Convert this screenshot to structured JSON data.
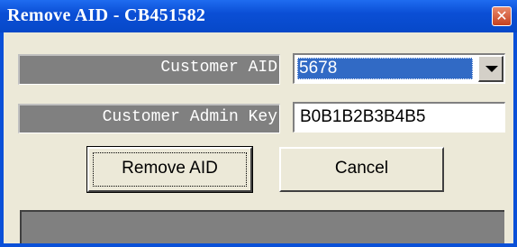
{
  "window": {
    "title": "Remove AID - CB451582",
    "close_icon": "close-icon",
    "titlebar_color": "#0a50d8",
    "close_color": "#c4401f"
  },
  "form": {
    "customer_aid_label": "Customer AID",
    "customer_aid_value": "5678",
    "customer_admin_key_label": "Customer Admin Key",
    "customer_admin_key_value": "B0B1B2B3B4B5"
  },
  "buttons": {
    "remove_label": "Remove AID",
    "cancel_label": "Cancel"
  },
  "status": {
    "text": ""
  }
}
